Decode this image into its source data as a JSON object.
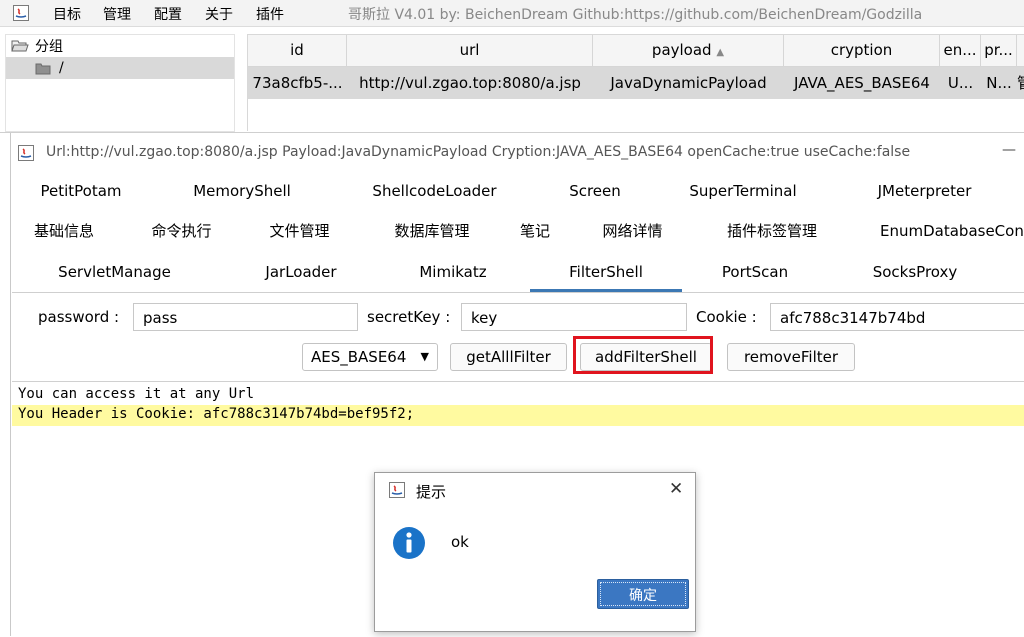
{
  "menubar": {
    "items": [
      "目标",
      "管理",
      "配置",
      "关于",
      "插件"
    ],
    "title": "哥斯拉   V4.01 by: BeichenDream Github:https://github.com/BeichenDream/Godzilla"
  },
  "tree": {
    "root_label": "分组",
    "child_label": "/"
  },
  "table": {
    "headers": [
      "id",
      "url",
      "payload",
      "cryption",
      "en...",
      "pr..."
    ],
    "sort_indicator": "▲",
    "row": [
      "73a8cfb5-...",
      "http://vul.zgao.top:8080/a.jsp",
      "JavaDynamicPayload",
      "JAVA_AES_BASE64",
      "U...",
      "N...",
      "管"
    ]
  },
  "inner_window": {
    "title": "Url:http://vul.zgao.top:8080/a.jsp Payload:JavaDynamicPayload Cryption:JAVA_AES_BASE64 openCache:true useCache:false",
    "minimize": "—"
  },
  "tabs": {
    "row1": [
      "PetitPotam",
      "MemoryShell",
      "ShellcodeLoader",
      "Screen",
      "SuperTerminal",
      "JMeterpreter"
    ],
    "row2": [
      "基础信息",
      "命令执行",
      "文件管理",
      "数据库管理",
      "笔记",
      "网络详情",
      "插件标签管理",
      "EnumDatabaseCon"
    ],
    "row3": [
      "ServletManage",
      "JarLoader",
      "Mimikatz",
      "FilterShell",
      "PortScan",
      "SocksProxy"
    ],
    "active": "FilterShell"
  },
  "form": {
    "password_label": "password :",
    "password_value": "pass",
    "secretkey_label": "secretKey :",
    "secretkey_value": "key",
    "cookie_label": "Cookie :",
    "cookie_value": "afc788c3147b74bd",
    "cipher_select": "AES_BASE64",
    "btn_getall": "getAlllFilter",
    "btn_add": "addFilterShell",
    "btn_remove": "removeFilter"
  },
  "output": {
    "line1": "You can access it at any Url",
    "line2": "You Header is Cookie: afc788c3147b74bd=bef95f2;"
  },
  "dialog": {
    "title": "提示",
    "message": "ok",
    "ok_button": "确定",
    "close": "✕"
  },
  "colors": {
    "highlight_line": "#fffaa0",
    "annotation_box": "#e0141e",
    "active_tab_underline": "#3c78b4",
    "info_icon": "#1a73c8",
    "ok_button": "#3b77c2"
  }
}
